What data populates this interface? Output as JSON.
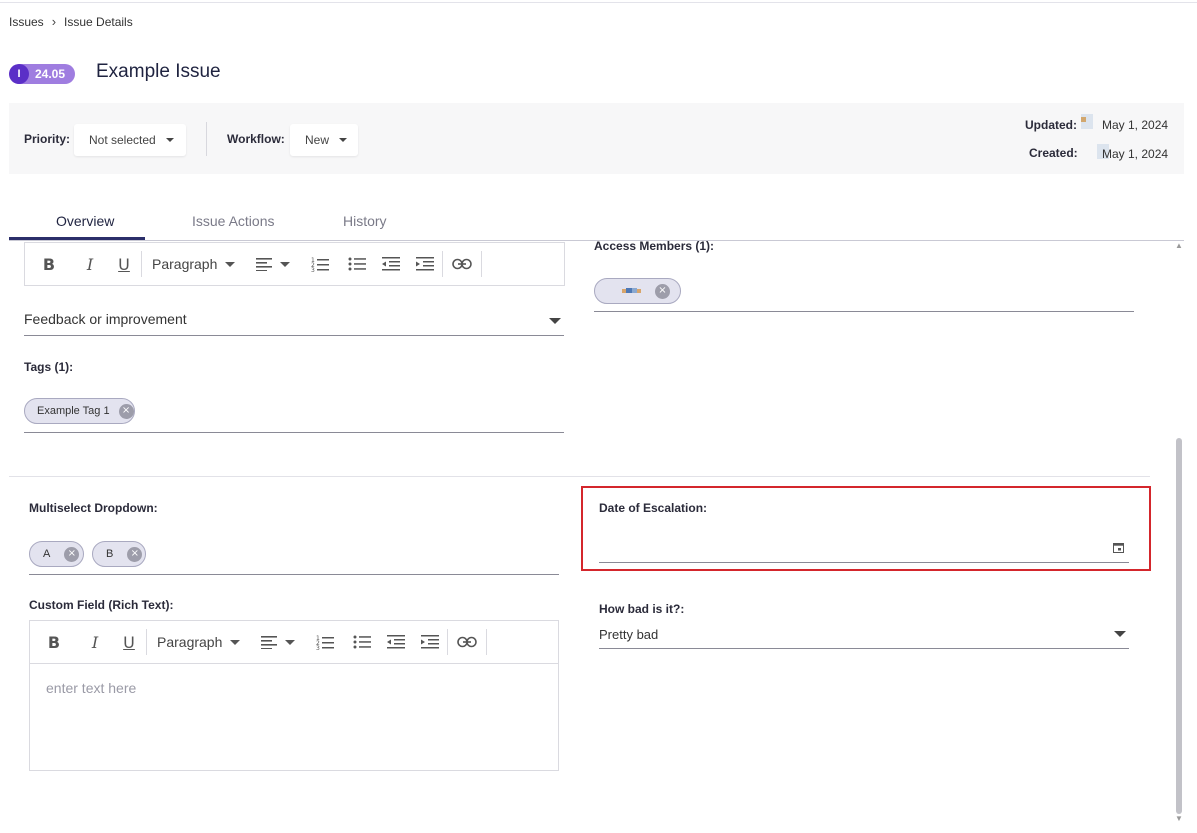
{
  "breadcrumb": {
    "root": "Issues",
    "separator": "›",
    "current": "Issue Details"
  },
  "issue": {
    "type_letter": "I",
    "version": "24.05",
    "title": "Example Issue"
  },
  "meta": {
    "priority_label": "Priority:",
    "priority_value": "Not selected",
    "workflow_label": "Workflow:",
    "workflow_value": "New",
    "updated_label": "Updated:",
    "updated_value": "May 1, 2024",
    "created_label": "Created:",
    "created_value": "May 1, 2024"
  },
  "tabs": [
    {
      "label": "Overview",
      "active": true
    },
    {
      "label": "Issue Actions",
      "active": false
    },
    {
      "label": "History",
      "active": false
    }
  ],
  "toolbar": {
    "paragraph_label": "Paragraph",
    "bold": "B",
    "italic": "I",
    "underline": "U"
  },
  "type_field": {
    "value": "Feedback or improvement"
  },
  "tags": {
    "label": "Tags (1):",
    "items": [
      "Example Tag 1"
    ]
  },
  "access_members": {
    "label": "Access Members (1):"
  },
  "multiselect": {
    "label": "Multiselect Dropdown:",
    "items": [
      "A",
      "B"
    ]
  },
  "rich_text": {
    "label": "Custom Field (Rich Text):",
    "placeholder": "enter text here"
  },
  "escalation": {
    "label": "Date of Escalation:",
    "value": ""
  },
  "how_bad": {
    "label": "How bad is it?:",
    "value": "Pretty bad"
  },
  "colors": {
    "accent": "#5b2fc7",
    "badge": "#9f7de0",
    "highlight": "#d4262c",
    "tab_active": "#2b2e6a"
  },
  "icons": [
    "chevron-right-icon",
    "caret-down-icon",
    "calendar-icon",
    "close-icon",
    "bold-icon",
    "italic-icon",
    "underline-icon",
    "align-left-icon",
    "ordered-list-icon",
    "bullet-list-icon",
    "outdent-icon",
    "indent-icon",
    "link-icon"
  ]
}
